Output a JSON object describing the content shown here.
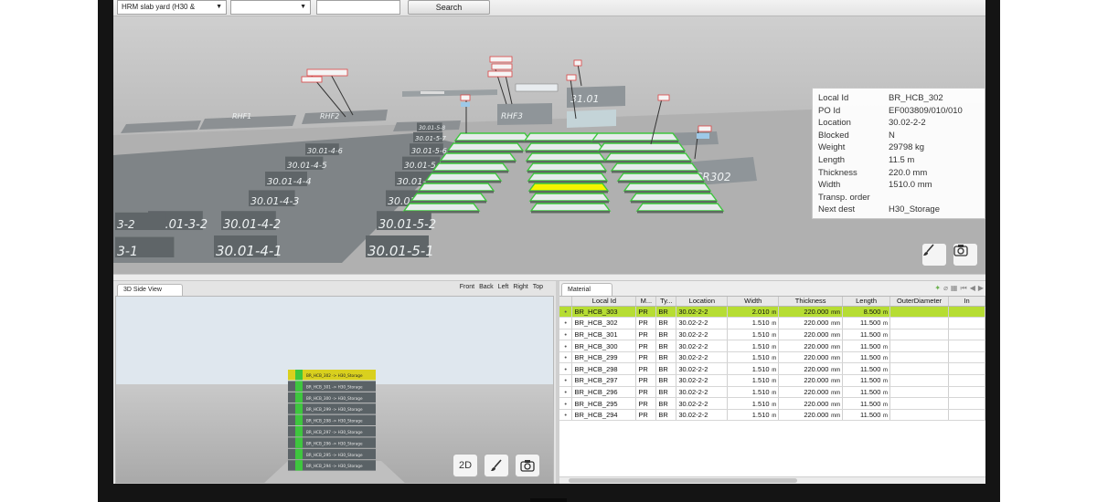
{
  "toolbar": {
    "area_select": "HRM slab yard (H30 & ",
    "second_select": "",
    "search_value": "",
    "search_button": "Search"
  },
  "scene": {
    "location_labels": [
      "30.01-5-1",
      "30.01-4-1",
      "30.01-5-2",
      "30.01-4-2",
      "30.01-3-2",
      "30.01-5-3",
      "30.01-4-3",
      "30.01-5-4",
      "30.01-4-4",
      "30.01-5-5",
      "30.01-4-5",
      "30.01-5-6",
      "30.01-4-6",
      "30.01-5-7",
      "30.01-5-8",
      "3-1",
      "3-2",
      "RHF1",
      "RHF2",
      "RHF3",
      "31.01",
      "CR302"
    ]
  },
  "info": {
    "rows": [
      {
        "label": "Local Id",
        "value": "BR_HCB_302"
      },
      {
        "label": "PO Id",
        "value": "EF003809/010/010"
      },
      {
        "label": "Location",
        "value": "30.02-2-2"
      },
      {
        "label": "Blocked",
        "value": "N"
      },
      {
        "label": "Weight",
        "value": "29798 kg"
      },
      {
        "label": "Length",
        "value": "11.5 m"
      },
      {
        "label": "Thickness",
        "value": "220.0 mm"
      },
      {
        "label": "Width",
        "value": "1510.0 mm"
      },
      {
        "label": "Transp. order",
        "value": ""
      },
      {
        "label": "Next dest",
        "value": "H30_Storage"
      }
    ]
  },
  "buttons": {
    "view2d": "2D"
  },
  "sideview": {
    "tab": "3D Side View",
    "views": [
      "Front",
      "Back",
      "Left",
      "Right",
      "Top"
    ],
    "stack": [
      "BR_HCB_302 -> H30_Storage",
      "BR_HCB_301 -> H30_Storage",
      "BR_HCB_300 -> H30_Storage",
      "BR_HCB_299 -> H30_Storage",
      "BR_HCB_298 -> H30_Storage",
      "BR_HCB_297 -> H30_Storage",
      "BR_HCB_296 -> H30_Storage",
      "BR_HCB_295 -> H30_Storage",
      "BR_HCB_294 -> H30_Storage"
    ]
  },
  "material": {
    "tab": "Material",
    "columns": [
      "Local Id",
      "M...",
      "Ty...",
      "Location",
      "Width",
      "Thickness",
      "Length",
      "OuterDiameter",
      "In"
    ],
    "rows": [
      {
        "id": "BR_HCB_303",
        "m": "PR",
        "t": "BR",
        "loc": "30.02-2-2",
        "width": "2.010",
        "wu": "m",
        "thick": "220.000",
        "tu": "mm",
        "len": "8.500",
        "lu": "m"
      },
      {
        "id": "BR_HCB_302",
        "m": "PR",
        "t": "BR",
        "loc": "30.02-2-2",
        "width": "1.510",
        "wu": "m",
        "thick": "220.000",
        "tu": "mm",
        "len": "11.500",
        "lu": "m"
      },
      {
        "id": "BR_HCB_301",
        "m": "PR",
        "t": "BR",
        "loc": "30.02-2-2",
        "width": "1.510",
        "wu": "m",
        "thick": "220.000",
        "tu": "mm",
        "len": "11.500",
        "lu": "m"
      },
      {
        "id": "BR_HCB_300",
        "m": "PR",
        "t": "BR",
        "loc": "30.02-2-2",
        "width": "1.510",
        "wu": "m",
        "thick": "220.000",
        "tu": "mm",
        "len": "11.500",
        "lu": "m"
      },
      {
        "id": "BR_HCB_299",
        "m": "PR",
        "t": "BR",
        "loc": "30.02-2-2",
        "width": "1.510",
        "wu": "m",
        "thick": "220.000",
        "tu": "mm",
        "len": "11.500",
        "lu": "m"
      },
      {
        "id": "BR_HCB_298",
        "m": "PR",
        "t": "BR",
        "loc": "30.02-2-2",
        "width": "1.510",
        "wu": "m",
        "thick": "220.000",
        "tu": "mm",
        "len": "11.500",
        "lu": "m"
      },
      {
        "id": "BR_HCB_297",
        "m": "PR",
        "t": "BR",
        "loc": "30.02-2-2",
        "width": "1.510",
        "wu": "m",
        "thick": "220.000",
        "tu": "mm",
        "len": "11.500",
        "lu": "m"
      },
      {
        "id": "BR_HCB_296",
        "m": "PR",
        "t": "BR",
        "loc": "30.02-2-2",
        "width": "1.510",
        "wu": "m",
        "thick": "220.000",
        "tu": "mm",
        "len": "11.500",
        "lu": "m"
      },
      {
        "id": "BR_HCB_295",
        "m": "PR",
        "t": "BR",
        "loc": "30.02-2-2",
        "width": "1.510",
        "wu": "m",
        "thick": "220.000",
        "tu": "mm",
        "len": "11.500",
        "lu": "m"
      },
      {
        "id": "BR_HCB_294",
        "m": "PR",
        "t": "BR",
        "loc": "30.02-2-2",
        "width": "1.510",
        "wu": "m",
        "thick": "220.000",
        "tu": "mm",
        "len": "11.500",
        "lu": "m"
      }
    ]
  },
  "colors": {
    "selected_row": "#b6dd33",
    "slab_green": "#3ec63e",
    "slab_highlight": "#f5f500"
  }
}
